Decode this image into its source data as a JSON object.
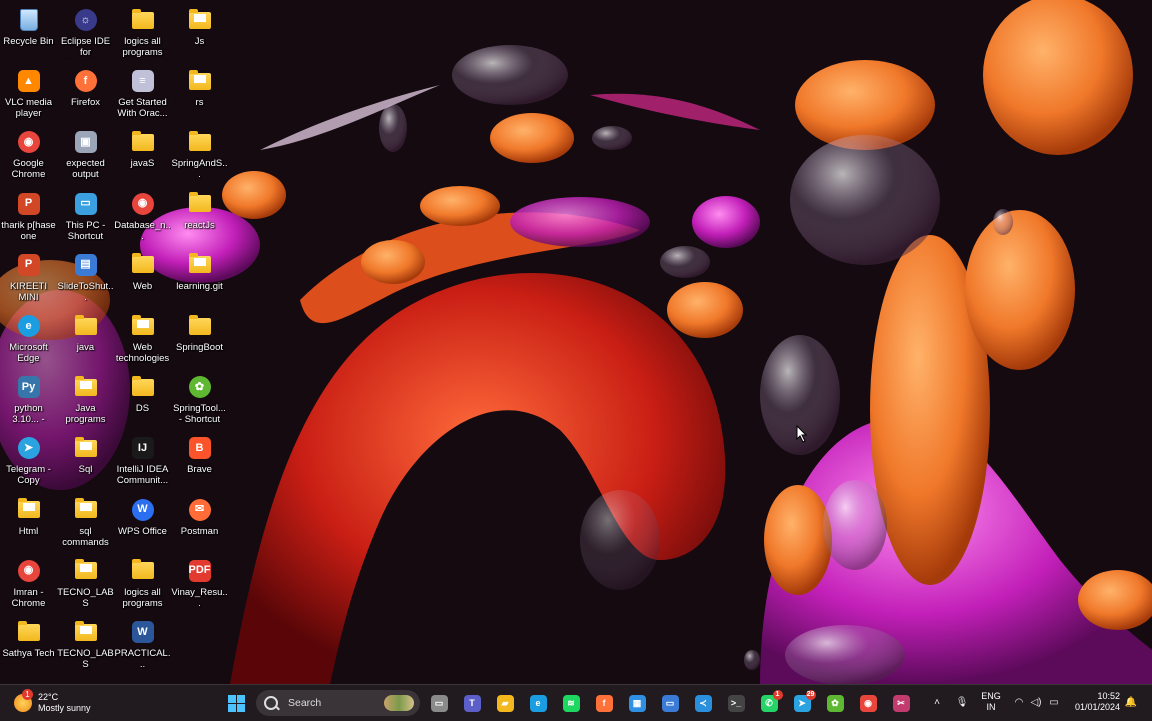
{
  "desktop": {
    "icons": [
      {
        "label": "Recycle Bin",
        "icon": "recycle-bin-icon"
      },
      {
        "label": "Eclipse IDE for Enterpris...",
        "icon": "eclipse-icon"
      },
      {
        "label": "logics all programs",
        "icon": "folder-icon"
      },
      {
        "label": "Js",
        "icon": "folder-icon"
      },
      {
        "label": "VLC media player",
        "icon": "vlc-icon"
      },
      {
        "label": "Firefox",
        "icon": "firefox-icon"
      },
      {
        "label": "Get Started With Orac...",
        "icon": "oracle-db-icon"
      },
      {
        "label": "rs",
        "icon": "folder-icon"
      },
      {
        "label": "Google Chrome",
        "icon": "chrome-icon"
      },
      {
        "label": "expected output",
        "icon": "image-file-icon"
      },
      {
        "label": "javaS",
        "icon": "folder-icon"
      },
      {
        "label": "SpringAndS...",
        "icon": "folder-icon"
      },
      {
        "label": "tharik p[hase one",
        "icon": "powerpoint-icon"
      },
      {
        "label": "This PC - Shortcut",
        "icon": "this-pc-icon"
      },
      {
        "label": "Database_n...",
        "icon": "chrome-icon"
      },
      {
        "label": "reactJs",
        "icon": "folder-icon"
      },
      {
        "label": "KIREETI MINI",
        "icon": "powerpoint-icon"
      },
      {
        "label": "SlideToShut...",
        "icon": "shutdown-shortcut-icon"
      },
      {
        "label": "Web",
        "icon": "folder-icon"
      },
      {
        "label": "learning.git",
        "icon": "folder-icon"
      },
      {
        "label": "Microsoft Edge",
        "icon": "edge-icon"
      },
      {
        "label": "java",
        "icon": "folder-icon"
      },
      {
        "label": "Web technologies",
        "icon": "folder-icon"
      },
      {
        "label": "SpringBoot",
        "icon": "folder-icon"
      },
      {
        "label": "python 3.10... - Shortcut",
        "icon": "python-icon"
      },
      {
        "label": "Java programs",
        "icon": "folder-icon"
      },
      {
        "label": "DS",
        "icon": "folder-icon"
      },
      {
        "label": "SpringTool... - Shortcut",
        "icon": "spring-tool-icon"
      },
      {
        "label": "Telegram - Copy",
        "icon": "telegram-icon"
      },
      {
        "label": "Sql",
        "icon": "folder-icon"
      },
      {
        "label": "IntelliJ IDEA Communit...",
        "icon": "intellij-icon"
      },
      {
        "label": "Brave",
        "icon": "brave-icon"
      },
      {
        "label": "Html",
        "icon": "folder-icon"
      },
      {
        "label": "sql commands",
        "icon": "folder-icon"
      },
      {
        "label": "WPS Office",
        "icon": "wps-office-icon"
      },
      {
        "label": "Postman",
        "icon": "postman-icon"
      },
      {
        "label": "Imran - Chrome",
        "icon": "chrome-icon"
      },
      {
        "label": "TECNO_LABS",
        "icon": "folder-icon"
      },
      {
        "label": "logics all programs",
        "icon": "folder-icon"
      },
      {
        "label": "Vinay_Resu...",
        "icon": "pdf-icon"
      },
      {
        "label": "Sathya Tech",
        "icon": "folder-icon"
      },
      {
        "label": "TECNO_LABS",
        "icon": "folder-icon"
      },
      {
        "label": "PRACTICAL...",
        "icon": "word-icon"
      }
    ]
  },
  "taskbar": {
    "weather": {
      "temp": "22°C",
      "condition": "Mostly sunny",
      "badge": "1"
    },
    "search_placeholder": "Search",
    "pinned": [
      {
        "name": "task-view-icon",
        "glyph": "▭",
        "color": "#8a8a8a"
      },
      {
        "name": "teams-icon",
        "glyph": "T",
        "color": "#5b5fc7"
      },
      {
        "name": "file-explorer-icon",
        "glyph": "▰",
        "color": "#f2b81e"
      },
      {
        "name": "edge-icon",
        "glyph": "e",
        "color": "#1b9de2"
      },
      {
        "name": "spotify-icon",
        "glyph": "≋",
        "color": "#1ed760"
      },
      {
        "name": "firefox-icon",
        "glyph": "f",
        "color": "#ff7139"
      },
      {
        "name": "store-icon",
        "glyph": "▦",
        "color": "#2f8fe3"
      },
      {
        "name": "screen-icon",
        "glyph": "▭",
        "color": "#3a7bd5"
      },
      {
        "name": "vscode-icon",
        "glyph": "≺",
        "color": "#2a8fdd"
      },
      {
        "name": "terminal-icon",
        "glyph": ">_",
        "color": "#444"
      },
      {
        "name": "whatsapp-icon",
        "glyph": "✆",
        "color": "#25d366",
        "badge": "1"
      },
      {
        "name": "telegram-icon",
        "glyph": "➤",
        "color": "#2aa3e0",
        "badge": "29"
      },
      {
        "name": "spring-tool-icon",
        "glyph": "✿",
        "color": "#5fb832"
      },
      {
        "name": "chrome-icon",
        "glyph": "◉",
        "color": "#e8453c"
      },
      {
        "name": "snipping-tool-icon",
        "glyph": "✂",
        "color": "#c23b6f"
      }
    ],
    "tray": {
      "language_top": "ENG",
      "language_bottom": "IN",
      "time": "10:52",
      "date": "01/01/2024"
    }
  }
}
